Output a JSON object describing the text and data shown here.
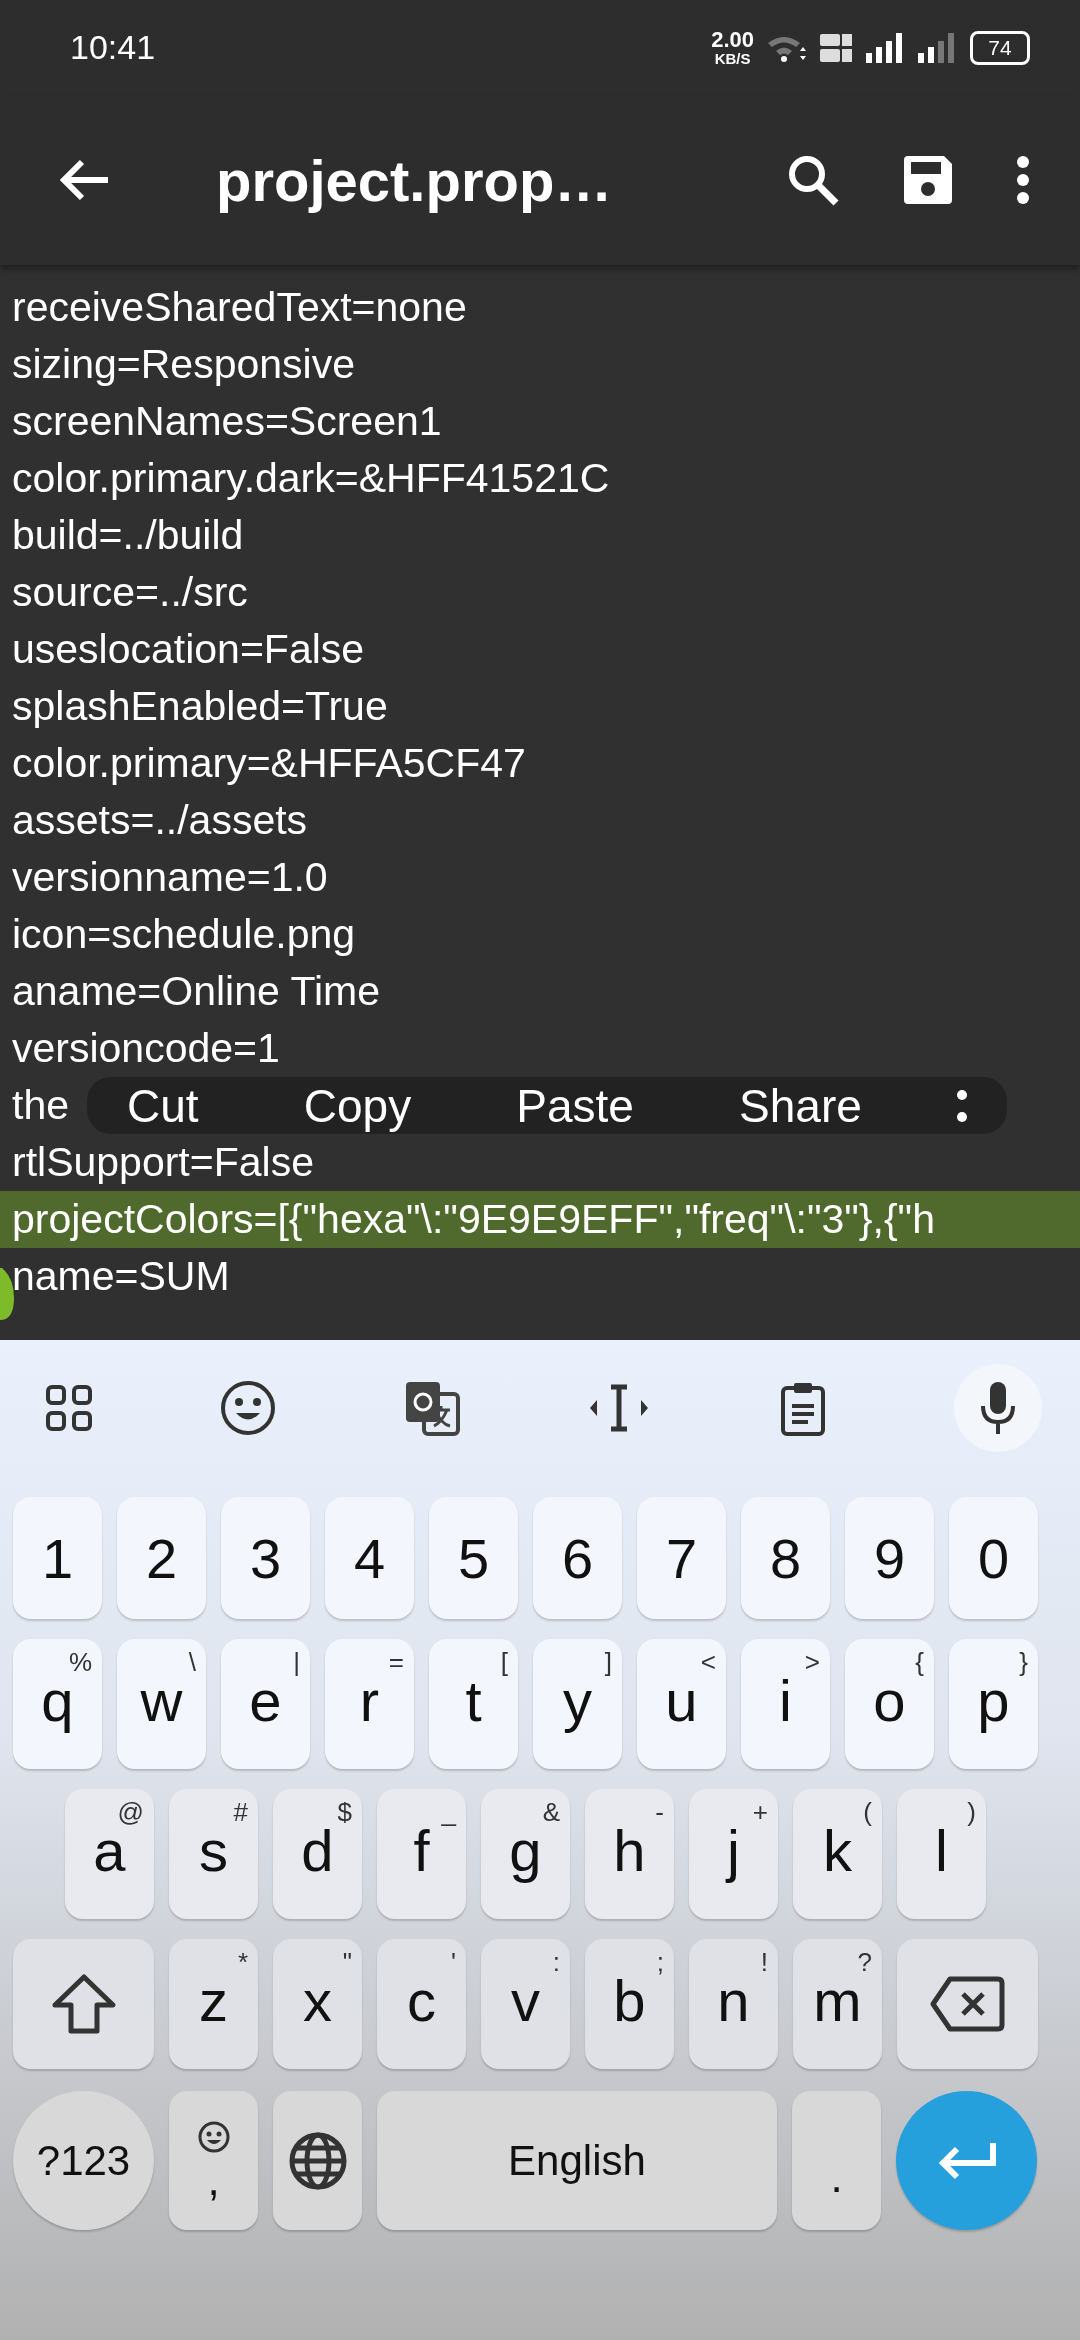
{
  "status_bar": {
    "time": "10:41",
    "net_speed": "2.00",
    "net_unit": "KB/S",
    "battery": "74"
  },
  "app_bar": {
    "title": "project.prop…"
  },
  "editor": {
    "lines": [
      {
        "text": "receiveSharedText=none",
        "selected": false
      },
      {
        "text": "sizing=Responsive",
        "selected": false
      },
      {
        "text": "screenNames=Screen1",
        "selected": false
      },
      {
        "text": "color.primary.dark=&HFF41521C",
        "selected": false
      },
      {
        "text": "build=../build",
        "selected": false
      },
      {
        "text": "source=../src",
        "selected": false
      },
      {
        "text": "useslocation=False",
        "selected": false
      },
      {
        "text": "splashEnabled=True",
        "selected": false
      },
      {
        "text": "color.primary=&HFFA5CF47",
        "selected": false
      },
      {
        "text": "assets=../assets",
        "selected": false
      },
      {
        "text": "versionname=1.0",
        "selected": false
      },
      {
        "text": "icon=schedule.png",
        "selected": false
      },
      {
        "text": "aname=Online Time",
        "selected": false
      },
      {
        "text": "versioncode=1",
        "selected": false
      },
      {
        "text": "the",
        "selected": false
      },
      {
        "text": "rtlSupport=False",
        "selected": false
      },
      {
        "text": "projectColors=[{\"hexa\"\\:\"9E9E9EFF\",\"freq\"\\:\"3\"},{\"h",
        "selected": true
      },
      {
        "text": "name=SUM",
        "selected": false
      }
    ]
  },
  "context_menu": {
    "items": [
      "Cut",
      "Copy",
      "Paste",
      "Share"
    ]
  },
  "keyboard": {
    "number_row": [
      "1",
      "2",
      "3",
      "4",
      "5",
      "6",
      "7",
      "8",
      "9",
      "0"
    ],
    "letter_rows": [
      [
        {
          "label": "q",
          "hint": "%"
        },
        {
          "label": "w",
          "hint": "\\"
        },
        {
          "label": "e",
          "hint": "|"
        },
        {
          "label": "r",
          "hint": "="
        },
        {
          "label": "t",
          "hint": "["
        },
        {
          "label": "y",
          "hint": "]"
        },
        {
          "label": "u",
          "hint": "<"
        },
        {
          "label": "i",
          "hint": ">"
        },
        {
          "label": "o",
          "hint": "{"
        },
        {
          "label": "p",
          "hint": "}"
        }
      ],
      [
        {
          "label": "a",
          "hint": "@"
        },
        {
          "label": "s",
          "hint": "#"
        },
        {
          "label": "d",
          "hint": "$"
        },
        {
          "label": "f",
          "hint": "_"
        },
        {
          "label": "g",
          "hint": "&"
        },
        {
          "label": "h",
          "hint": "-"
        },
        {
          "label": "j",
          "hint": "+"
        },
        {
          "label": "k",
          "hint": "("
        },
        {
          "label": "l",
          "hint": ")"
        }
      ],
      [
        {
          "label": "z",
          "hint": "*"
        },
        {
          "label": "x",
          "hint": "\""
        },
        {
          "label": "c",
          "hint": "'"
        },
        {
          "label": "v",
          "hint": ":"
        },
        {
          "label": "b",
          "hint": ";"
        },
        {
          "label": "n",
          "hint": "!"
        },
        {
          "label": "m",
          "hint": "?"
        }
      ]
    ],
    "bottom_row": {
      "symbols": "?123",
      "comma": ",",
      "space": "English",
      "period": "."
    }
  }
}
